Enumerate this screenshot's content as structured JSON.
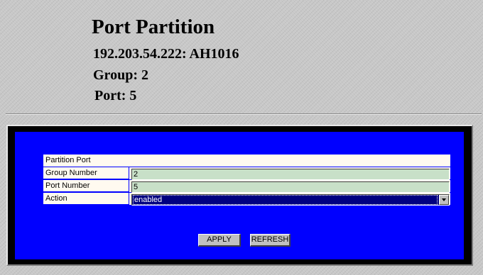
{
  "header": {
    "title": "Port Partition",
    "device": "192.203.54.222: AH1016",
    "group": "Group: 2",
    "port": "Port: 5"
  },
  "form": {
    "section_title": "Partition Port",
    "fields": [
      {
        "label": "Group Number",
        "value": "2"
      },
      {
        "label": "Port Number",
        "value": "5"
      },
      {
        "label": "Action",
        "value": "enabled"
      }
    ]
  },
  "buttons": {
    "apply": "APPLY",
    "refresh": "REFRESH"
  },
  "colors": {
    "panel_background": "#0000ff",
    "field_background": "#c8e0c8",
    "select_background": "#000080",
    "label_background": "#fffaf0"
  },
  "icons": {
    "dropdown": "chevron-down-icon"
  }
}
